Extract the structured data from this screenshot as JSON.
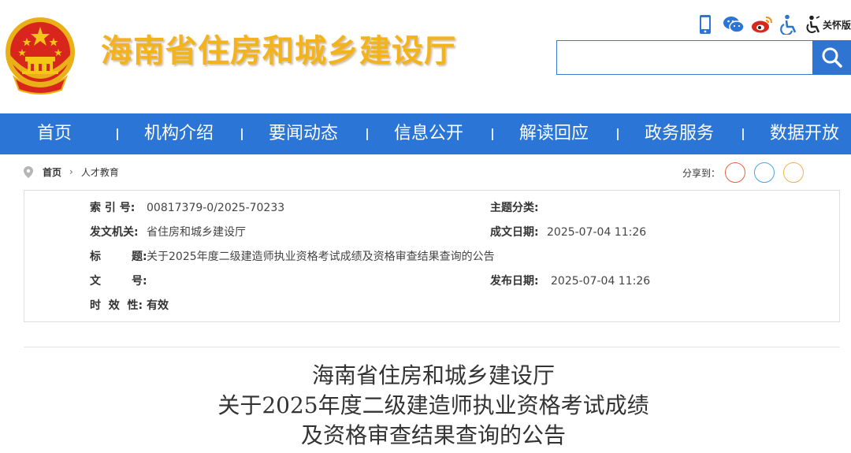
{
  "header": {
    "site_title": "海南省住房和城乡建设厅",
    "care_label": "关怀版",
    "search_placeholder": "",
    "accent_color": "#2b75d6",
    "title_color": "#f2b31c"
  },
  "top_icons": [
    "mobile-icon",
    "wechat-icon",
    "weibo-icon",
    "accessibility-icon",
    "elder-care-icon"
  ],
  "nav": {
    "items": [
      {
        "label": "首页"
      },
      {
        "label": "机构介绍"
      },
      {
        "label": "要闻动态"
      },
      {
        "label": "信息公开"
      },
      {
        "label": "解读回应"
      },
      {
        "label": "政务服务"
      },
      {
        "label": "数据开放"
      }
    ]
  },
  "breadcrumb": {
    "home": "首页",
    "current": "人才教育"
  },
  "share": {
    "label": "分享到：",
    "circle_colors": [
      "#e8623c",
      "#4aa3df",
      "#f2b34a"
    ]
  },
  "meta": {
    "index_label": "索  引  号:",
    "index_value": "00817379-0/2025-70233",
    "topic_label": "主题分类:",
    "topic_value": "",
    "issuer_label": "发文机关:",
    "issuer_value": "省住房和城乡建设厅",
    "created_label": "成文日期:",
    "created_value": "2025-07-04 11:26",
    "title_label": "标        题:",
    "title_value": "关于2025年度二级建造师执业资格考试成绩及资格审查结果查询的公告",
    "docno_label": "文        号:",
    "docno_value": "",
    "published_label": "发布日期:",
    "published_value": "2025-07-04 11:26",
    "validity_label": "时  效  性:",
    "validity_value": "有效"
  },
  "article": {
    "title_line1": "海南省住房和城乡建设厅",
    "title_line2": "关于2025年度二级建造师执业资格考试成绩",
    "title_line3": "及资格审查结果查询的公告"
  }
}
